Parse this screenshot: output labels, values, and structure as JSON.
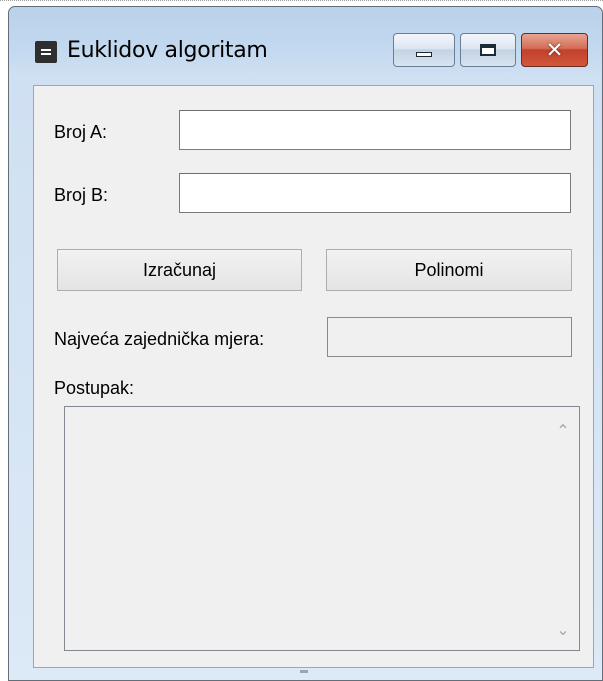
{
  "window": {
    "title": "Euklidov algoritam",
    "icon": "app-menu-icon",
    "controls": {
      "minimize_icon": "minimize-icon",
      "maximize_icon": "maximize-icon",
      "close_glyph": "✕"
    }
  },
  "form": {
    "broj_a_label": "Broj A:",
    "broj_a_value": "",
    "broj_b_label": "Broj B:",
    "broj_b_value": "",
    "izracunaj_label": "Izračunaj",
    "polinomi_label": "Polinomi",
    "nzm_label": "Najveća zajednička mjera:",
    "nzm_value": "",
    "postupak_label": "Postupak:",
    "postupak_value": "",
    "scroll_up_glyph": "⌃",
    "scroll_down_glyph": "⌄"
  },
  "colors": {
    "titlebar": "#c2d8ef",
    "client_background": "#f0f0f0",
    "close_button": "#c1412a"
  }
}
